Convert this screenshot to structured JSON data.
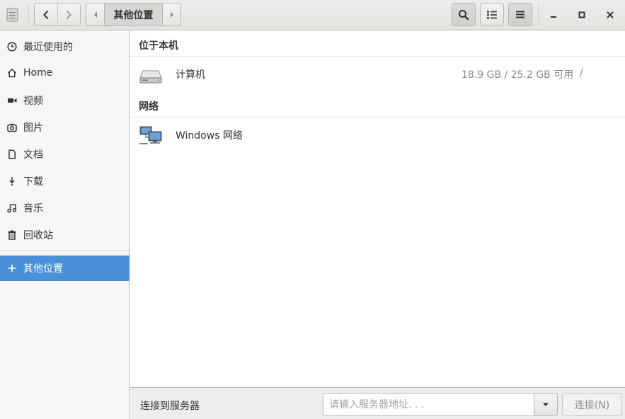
{
  "header": {
    "path_current": "其他位置",
    "icons": {
      "app": "file-manager-icon",
      "back": "chevron-left-icon",
      "forward": "chevron-right-icon",
      "path_left": "triangle-left-icon",
      "path_right": "triangle-right-icon",
      "search": "search-icon",
      "view": "list-view-icon",
      "menu": "hamburger-menu-icon",
      "minimize": "minimize-icon",
      "maximize": "maximize-icon",
      "close": "close-icon"
    }
  },
  "sidebar": {
    "items": [
      {
        "label": "最近使用的",
        "icon": "clock-icon"
      },
      {
        "label": "Home",
        "icon": "home-icon"
      },
      {
        "label": "视频",
        "icon": "video-icon"
      },
      {
        "label": "图片",
        "icon": "camera-icon"
      },
      {
        "label": "文档",
        "icon": "document-icon"
      },
      {
        "label": "下载",
        "icon": "download-icon"
      },
      {
        "label": "音乐",
        "icon": "music-icon"
      },
      {
        "label": "回收站",
        "icon": "trash-icon"
      }
    ],
    "other_locations": {
      "label": "其他位置",
      "icon": "plus-icon",
      "active": true
    }
  },
  "main": {
    "on_this_computer": {
      "title": "位于本机",
      "items": [
        {
          "name": "计算机",
          "usage": "18.9 GB / 25.2 GB 可用",
          "mount": "/",
          "icon": "hard-drive-icon"
        }
      ]
    },
    "network": {
      "title": "网络",
      "items": [
        {
          "name": "Windows 网络",
          "icon": "network-computers-icon"
        }
      ]
    }
  },
  "footer": {
    "label": "连接到服务器",
    "server_input": {
      "placeholder": "请输入服务器地址. . .",
      "value": ""
    },
    "connect_button": "连接(N)"
  },
  "colors": {
    "accent": "#4a90d9",
    "sidebar_bg": "#f6f6f5",
    "headerbar_bg": "#e8e8e6"
  }
}
